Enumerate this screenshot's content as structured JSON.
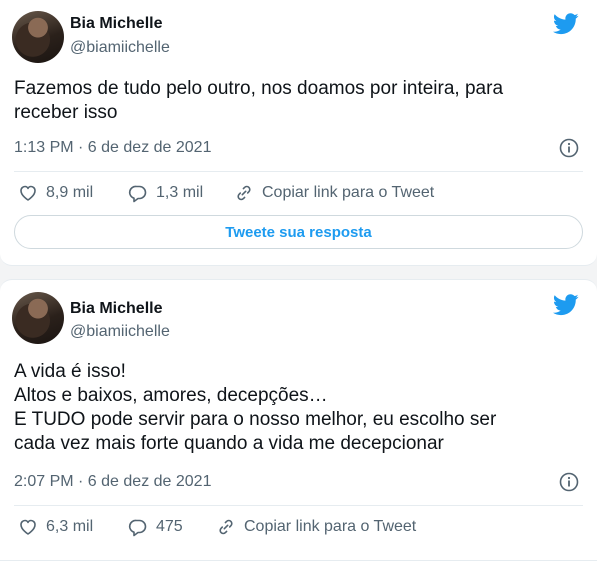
{
  "tweets": [
    {
      "name": "Bia Michelle",
      "handle": "@biamiichelle",
      "text": "Fazemos de tudo pelo outro, nos doamos por inteira, para\nreceber isso",
      "timestamp": "1:13 PM · 6 de dez de 2021",
      "likes": "8,9 mil",
      "replies": "1,3 mil",
      "copy_link": "Copiar link para o Tweet",
      "reply_button": "Tweete sua resposta"
    },
    {
      "name": "Bia Michelle",
      "handle": "@biamiichelle",
      "text": "A vida é isso!\nAltos e baixos, amores, decepções…\nE TUDO pode servir para o nosso melhor, eu escolho ser\ncada vez mais forte quando a vida me decepcionar",
      "timestamp": "2:07 PM · 6 de dez de 2021",
      "likes": "6,3 mil",
      "replies": "475",
      "copy_link": "Copiar link para o Tweet"
    }
  ],
  "colors": {
    "accent": "#1d9bf0",
    "muted": "#536471",
    "text": "#0f1419"
  },
  "icons": [
    "twitter-bird-icon",
    "info-icon",
    "heart-icon",
    "reply-icon",
    "link-icon"
  ]
}
